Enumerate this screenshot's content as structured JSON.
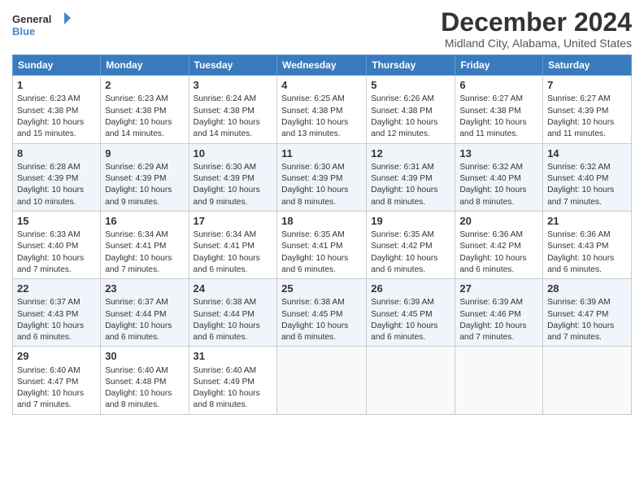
{
  "header": {
    "logo_line1": "General",
    "logo_line2": "Blue",
    "title": "December 2024",
    "subtitle": "Midland City, Alabama, United States"
  },
  "days_of_week": [
    "Sunday",
    "Monday",
    "Tuesday",
    "Wednesday",
    "Thursday",
    "Friday",
    "Saturday"
  ],
  "weeks": [
    [
      {
        "day": 1,
        "lines": [
          "Sunrise: 6:23 AM",
          "Sunset: 4:38 PM",
          "Daylight: 10 hours",
          "and 15 minutes."
        ]
      },
      {
        "day": 2,
        "lines": [
          "Sunrise: 6:23 AM",
          "Sunset: 4:38 PM",
          "Daylight: 10 hours",
          "and 14 minutes."
        ]
      },
      {
        "day": 3,
        "lines": [
          "Sunrise: 6:24 AM",
          "Sunset: 4:38 PM",
          "Daylight: 10 hours",
          "and 14 minutes."
        ]
      },
      {
        "day": 4,
        "lines": [
          "Sunrise: 6:25 AM",
          "Sunset: 4:38 PM",
          "Daylight: 10 hours",
          "and 13 minutes."
        ]
      },
      {
        "day": 5,
        "lines": [
          "Sunrise: 6:26 AM",
          "Sunset: 4:38 PM",
          "Daylight: 10 hours",
          "and 12 minutes."
        ]
      },
      {
        "day": 6,
        "lines": [
          "Sunrise: 6:27 AM",
          "Sunset: 4:38 PM",
          "Daylight: 10 hours",
          "and 11 minutes."
        ]
      },
      {
        "day": 7,
        "lines": [
          "Sunrise: 6:27 AM",
          "Sunset: 4:39 PM",
          "Daylight: 10 hours",
          "and 11 minutes."
        ]
      }
    ],
    [
      {
        "day": 8,
        "lines": [
          "Sunrise: 6:28 AM",
          "Sunset: 4:39 PM",
          "Daylight: 10 hours",
          "and 10 minutes."
        ]
      },
      {
        "day": 9,
        "lines": [
          "Sunrise: 6:29 AM",
          "Sunset: 4:39 PM",
          "Daylight: 10 hours",
          "and 9 minutes."
        ]
      },
      {
        "day": 10,
        "lines": [
          "Sunrise: 6:30 AM",
          "Sunset: 4:39 PM",
          "Daylight: 10 hours",
          "and 9 minutes."
        ]
      },
      {
        "day": 11,
        "lines": [
          "Sunrise: 6:30 AM",
          "Sunset: 4:39 PM",
          "Daylight: 10 hours",
          "and 8 minutes."
        ]
      },
      {
        "day": 12,
        "lines": [
          "Sunrise: 6:31 AM",
          "Sunset: 4:39 PM",
          "Daylight: 10 hours",
          "and 8 minutes."
        ]
      },
      {
        "day": 13,
        "lines": [
          "Sunrise: 6:32 AM",
          "Sunset: 4:40 PM",
          "Daylight: 10 hours",
          "and 8 minutes."
        ]
      },
      {
        "day": 14,
        "lines": [
          "Sunrise: 6:32 AM",
          "Sunset: 4:40 PM",
          "Daylight: 10 hours",
          "and 7 minutes."
        ]
      }
    ],
    [
      {
        "day": 15,
        "lines": [
          "Sunrise: 6:33 AM",
          "Sunset: 4:40 PM",
          "Daylight: 10 hours",
          "and 7 minutes."
        ]
      },
      {
        "day": 16,
        "lines": [
          "Sunrise: 6:34 AM",
          "Sunset: 4:41 PM",
          "Daylight: 10 hours",
          "and 7 minutes."
        ]
      },
      {
        "day": 17,
        "lines": [
          "Sunrise: 6:34 AM",
          "Sunset: 4:41 PM",
          "Daylight: 10 hours",
          "and 6 minutes."
        ]
      },
      {
        "day": 18,
        "lines": [
          "Sunrise: 6:35 AM",
          "Sunset: 4:41 PM",
          "Daylight: 10 hours",
          "and 6 minutes."
        ]
      },
      {
        "day": 19,
        "lines": [
          "Sunrise: 6:35 AM",
          "Sunset: 4:42 PM",
          "Daylight: 10 hours",
          "and 6 minutes."
        ]
      },
      {
        "day": 20,
        "lines": [
          "Sunrise: 6:36 AM",
          "Sunset: 4:42 PM",
          "Daylight: 10 hours",
          "and 6 minutes."
        ]
      },
      {
        "day": 21,
        "lines": [
          "Sunrise: 6:36 AM",
          "Sunset: 4:43 PM",
          "Daylight: 10 hours",
          "and 6 minutes."
        ]
      }
    ],
    [
      {
        "day": 22,
        "lines": [
          "Sunrise: 6:37 AM",
          "Sunset: 4:43 PM",
          "Daylight: 10 hours",
          "and 6 minutes."
        ]
      },
      {
        "day": 23,
        "lines": [
          "Sunrise: 6:37 AM",
          "Sunset: 4:44 PM",
          "Daylight: 10 hours",
          "and 6 minutes."
        ]
      },
      {
        "day": 24,
        "lines": [
          "Sunrise: 6:38 AM",
          "Sunset: 4:44 PM",
          "Daylight: 10 hours",
          "and 6 minutes."
        ]
      },
      {
        "day": 25,
        "lines": [
          "Sunrise: 6:38 AM",
          "Sunset: 4:45 PM",
          "Daylight: 10 hours",
          "and 6 minutes."
        ]
      },
      {
        "day": 26,
        "lines": [
          "Sunrise: 6:39 AM",
          "Sunset: 4:45 PM",
          "Daylight: 10 hours",
          "and 6 minutes."
        ]
      },
      {
        "day": 27,
        "lines": [
          "Sunrise: 6:39 AM",
          "Sunset: 4:46 PM",
          "Daylight: 10 hours",
          "and 7 minutes."
        ]
      },
      {
        "day": 28,
        "lines": [
          "Sunrise: 6:39 AM",
          "Sunset: 4:47 PM",
          "Daylight: 10 hours",
          "and 7 minutes."
        ]
      }
    ],
    [
      {
        "day": 29,
        "lines": [
          "Sunrise: 6:40 AM",
          "Sunset: 4:47 PM",
          "Daylight: 10 hours",
          "and 7 minutes."
        ]
      },
      {
        "day": 30,
        "lines": [
          "Sunrise: 6:40 AM",
          "Sunset: 4:48 PM",
          "Daylight: 10 hours",
          "and 8 minutes."
        ]
      },
      {
        "day": 31,
        "lines": [
          "Sunrise: 6:40 AM",
          "Sunset: 4:49 PM",
          "Daylight: 10 hours",
          "and 8 minutes."
        ]
      },
      null,
      null,
      null,
      null
    ]
  ]
}
